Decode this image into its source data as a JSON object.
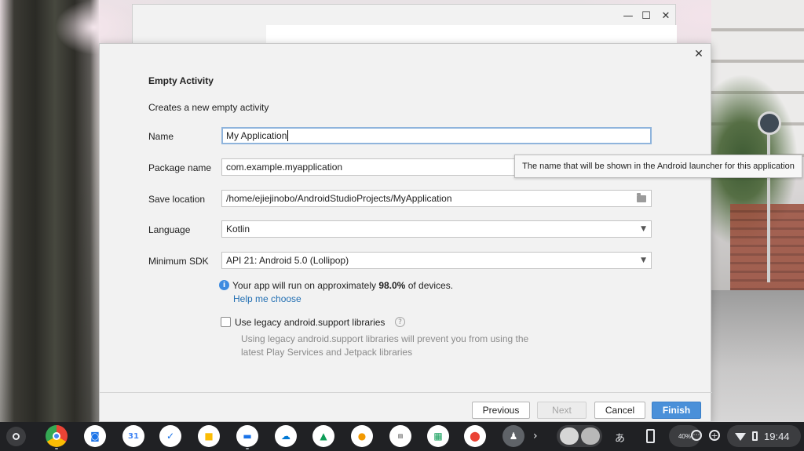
{
  "wizard": {
    "heading": "Empty Activity",
    "description": "Creates a new empty activity",
    "fields": {
      "name": {
        "label": "Name",
        "value": "My Application"
      },
      "package": {
        "label": "Package name",
        "value": "com.example.myapplication"
      },
      "save_location": {
        "label": "Save location",
        "value": "/home/ejiejinobo/AndroidStudioProjects/MyApplication"
      },
      "language": {
        "label": "Language",
        "value": "Kotlin"
      },
      "min_sdk": {
        "label": "Minimum SDK",
        "value": "API 21: Android 5.0 (Lollipop)"
      }
    },
    "tooltip": "The name that will be shown in the Android launcher for this application",
    "info": {
      "prefix": "Your app will run on approximately ",
      "percent": "98.0%",
      "suffix": " of devices.",
      "help_link": "Help me choose"
    },
    "legacy": {
      "label": "Use legacy android.support libraries",
      "description": "Using legacy android.support libraries will prevent you from using the latest Play Services and Jetpack libraries",
      "checked": false
    },
    "buttons": {
      "previous": "Previous",
      "next": "Next",
      "cancel": "Cancel",
      "finish": "Finish"
    }
  },
  "shelf": {
    "apps": [
      {
        "name": "chrome",
        "color": "#34a853"
      },
      {
        "name": "camera",
        "color": "#1a73e8"
      },
      {
        "name": "calendar",
        "color": "#4285f4",
        "label": "31"
      },
      {
        "name": "tasks",
        "color": "#1a73e8"
      },
      {
        "name": "keep",
        "color": "#fbbc04"
      },
      {
        "name": "files",
        "color": "#1a73e8"
      },
      {
        "name": "onedrive",
        "color": "#0078d4"
      },
      {
        "name": "drive",
        "color": "#0f9d58"
      },
      {
        "name": "photos-app",
        "color": "#f29900"
      },
      {
        "name": "news",
        "color": "#e8e8e8"
      },
      {
        "name": "classroom",
        "color": "#0f9d58"
      },
      {
        "name": "maps",
        "color": "#34a853"
      },
      {
        "name": "reader",
        "color": "#5f6368"
      }
    ],
    "ime": "あ",
    "battery_percent": "40%",
    "clock": "19:44"
  }
}
